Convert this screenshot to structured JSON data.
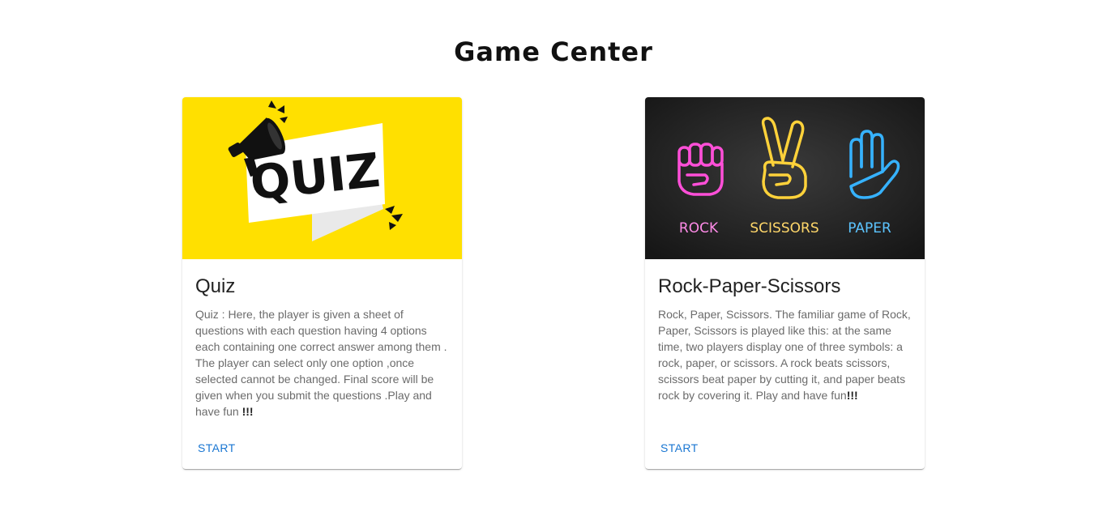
{
  "header": {
    "title": "Game Center"
  },
  "cards": [
    {
      "title": "Quiz",
      "description": "Quiz : Here, the player is given a sheet of questions with each question having 4 options each containing one correct answer among them . The player can select only one option ,once selected cannot be changed. Final score will be given when you submit the questions .Play and have fun ",
      "description_emphasis": "!!!",
      "image_text": "QUIZ",
      "action_label": "START"
    },
    {
      "title": "Rock-Paper-Scissors",
      "description": "Rock, Paper, Scissors. The familiar game of Rock, Paper, Scissors is played like this: at the same time, two players display one of three symbols: a rock, paper, or scissors. A rock beats scissors, scissors beat paper by cutting it, and paper beats rock by covering it. Play and have fun",
      "description_emphasis": "!!!",
      "image_labels": {
        "rock": "ROCK",
        "scissors": "SCISSORS",
        "paper": "PAPER"
      },
      "action_label": "START"
    }
  ],
  "colors": {
    "quiz_background": "#ffe000",
    "rps_background": "#2a2a2a",
    "rock_neon": "#ff4fd8",
    "scissors_neon": "#ffd23a",
    "paper_neon": "#36b2ff",
    "action": "#1976d2"
  }
}
